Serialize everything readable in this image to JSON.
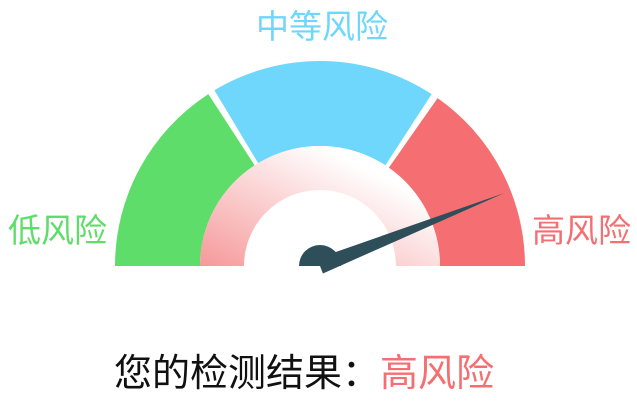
{
  "gauge": {
    "labels": {
      "low": "低风险",
      "medium": "中等风险",
      "high": "高风险"
    },
    "colors": {
      "low": "#5fdd6a",
      "medium": "#6ed7fb",
      "high": "#f56f72",
      "needle": "#2e4f5a",
      "inner_start": "#f6999a",
      "inner_end": "#ffffff"
    },
    "needle_level": 0.88
  },
  "result": {
    "prefix": "您的检测结果：",
    "value": "高风险"
  }
}
